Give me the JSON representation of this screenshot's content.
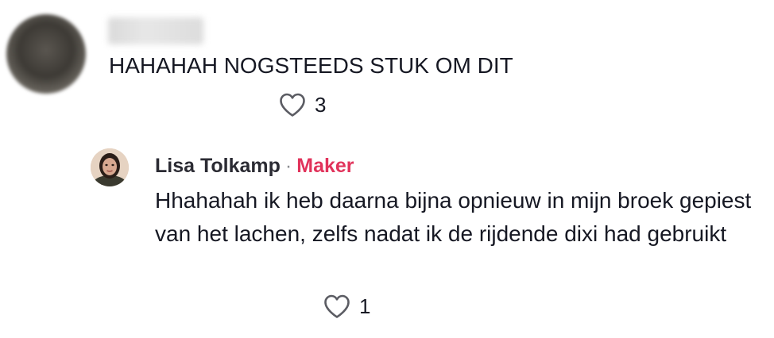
{
  "comment": {
    "text": "HAHAHAH NOGSTEEDS STUK OM DIT",
    "likes": "3",
    "like_icon": "heart-outline-icon"
  },
  "reply": {
    "author": "Lisa Tolkamp",
    "separator": "·",
    "badge": "Maker",
    "badge_color": "#e1335b",
    "text": "Hhahahah ik heb daarna bijna opnieuw in mijn broek gepiest van het lachen, zelfs nadat ik de rijdende dixi had gebruikt",
    "likes": "1",
    "like_icon": "heart-outline-icon"
  }
}
